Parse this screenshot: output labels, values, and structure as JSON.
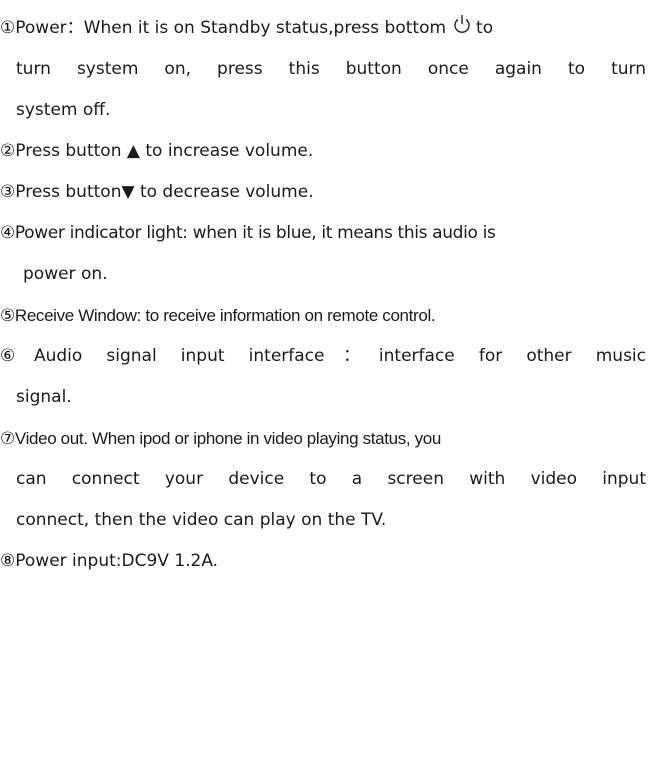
{
  "items": [
    {
      "marker": "①",
      "lines": [
        "Power：When it is on Standby status,press bottom",
        "to",
        "turn system on, press this button once again to turn",
        "system off."
      ],
      "icon": "power-icon"
    },
    {
      "marker": "②",
      "lines": [
        "Press button ▲ to increase volume."
      ]
    },
    {
      "marker": "③",
      "lines": [
        "Press button▼ to decrease volume."
      ]
    },
    {
      "marker": "④",
      "lines": [
        "Power indicator light: when it is blue, it means this audio is",
        "power on."
      ]
    },
    {
      "marker": "⑤",
      "lines": [
        "Receive Window: to receive information on remote control."
      ]
    },
    {
      "marker": "⑥",
      "lines": [
        "Audio signal input interface：interface for other music",
        "signal."
      ]
    },
    {
      "marker": "⑦",
      "lines": [
        "Video out. When ipod or iphone in video playing status, you",
        "can connect your device to a screen with video input",
        "connect, then the video can play on the TV."
      ]
    },
    {
      "marker": "⑧",
      "lines": [
        "Power input:DC9V 1.2A."
      ]
    }
  ]
}
